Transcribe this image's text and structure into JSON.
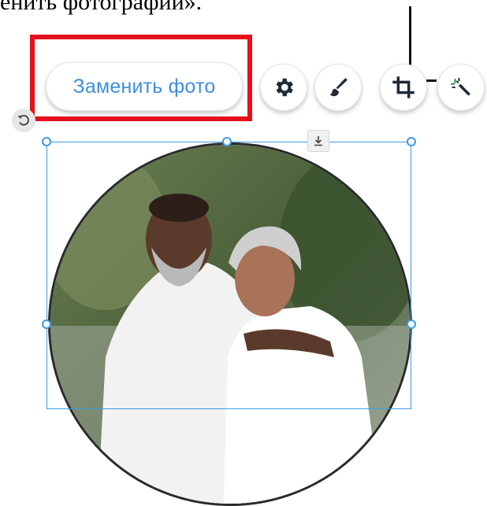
{
  "caption": {
    "text": "енить фотографии»."
  },
  "toolbar": {
    "replace_photo_label": "Заменить фото",
    "settings_icon": "gear-icon",
    "design_icon": "brush-icon",
    "crop_icon": "crop-icon",
    "enhance_icon": "magic-wand-icon",
    "rotate_icon": "rotate-icon",
    "anchor_icon": "download-icon"
  },
  "colors": {
    "accent": "#3d8fe0",
    "highlight": "#e5101e",
    "selection": "#3f9ae6"
  }
}
